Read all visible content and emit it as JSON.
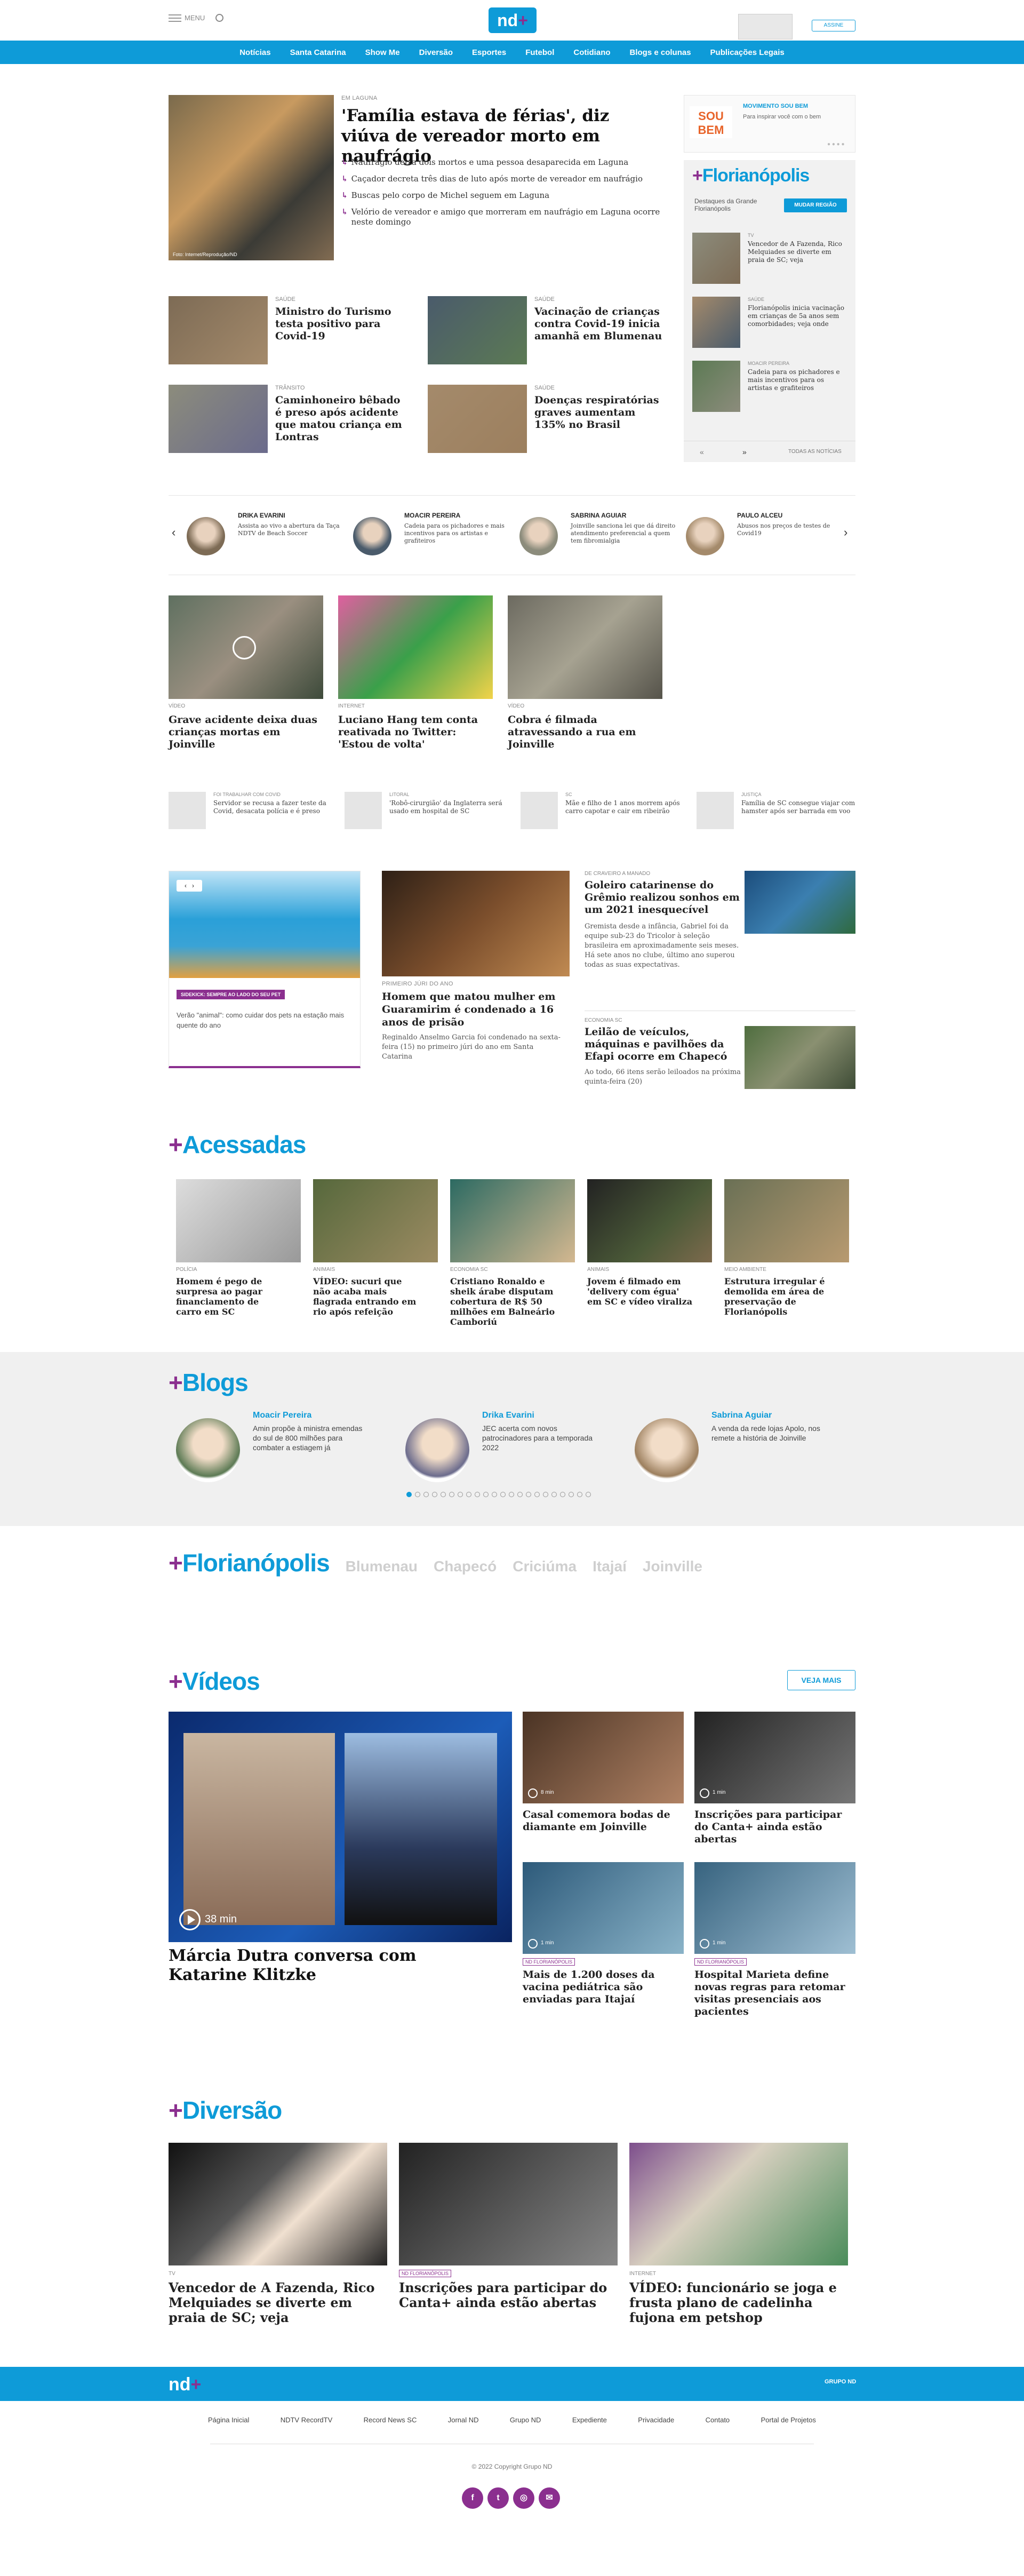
{
  "header": {
    "menu_label": "MENU",
    "subscribe_label": "ASSINE"
  },
  "nav": [
    "Notícias",
    "Santa Catarina",
    "Show Me",
    "Diversão",
    "Esportes",
    "Futebol",
    "Cotidiano",
    "Blogs e colunas",
    "Publicações Legais"
  ],
  "lead": {
    "kicker": "EM LAGUNA",
    "title": "'Família estava de férias', diz viúva de vereador morto em naufrágio",
    "credit": "Foto: Internet/Reprodução/ND",
    "bullets": [
      "Naufrágio deixa dois mortos e uma pessoa desaparecida em Laguna",
      "Caçador decreta três dias de luto após morte de vereador em naufrágio",
      "Buscas pelo corpo de Michel seguem em Laguna",
      "Velório de vereador e amigo que morreram em naufrágio em Laguna ocorre neste domingo"
    ]
  },
  "grid": [
    {
      "kicker": "SAÚDE",
      "title": "Ministro do Turismo testa positivo para Covid-19"
    },
    {
      "kicker": "SAÚDE",
      "title": "Vacinação de crianças contra Covid-19 inicia amanhã em Blumenau"
    },
    {
      "kicker": "TRÂNSITO",
      "title": "Caminhoneiro bêbado é preso após acidente que matou criança em Lontras"
    },
    {
      "kicker": "SAÚDE",
      "title": "Doenças respiratórias graves aumentam 135% no Brasil"
    }
  ],
  "promo": {
    "kicker": "MOVIMENTO SOU BEM",
    "line": "Para inspirar você com o bem",
    "logo": "SOU BEM"
  },
  "floripa_box": {
    "title": "Florianópolis",
    "subtitle": "Destaques da Grande Florianópolis",
    "button": "MUDAR REGIÃO",
    "items": [
      {
        "kicker": "TV",
        "title": "Vencedor de A Fazenda, Rico Melquiades se diverte em praia de SC; veja"
      },
      {
        "kicker": "SAÚDE",
        "title": "Florianópolis inicia vacinação em crianças de 5a anos sem comorbidades; veja onde"
      },
      {
        "kicker": "MOACIR PEREIRA",
        "title": "Cadeia para os pichadores e mais incentivos para os artistas e grafiteiros"
      }
    ],
    "all_label": "TODAS AS NOTÍCIAS"
  },
  "columnists": [
    {
      "name": "DRIKA EVARINI",
      "text": "Assista ao vivo a abertura da Taça NDTV de Beach Soccer"
    },
    {
      "name": "MOACIR PEREIRA",
      "text": "Cadeia para os pichadores e mais incentivos para os artistas e grafiteiros"
    },
    {
      "name": "SABRINA AGUIAR",
      "text": "Joinville sanciona lei que dá direito atendimento preferencial a quem tem fibromialgia"
    },
    {
      "name": "PAULO ALCEU",
      "text": "Abusos nos preços de testes de Covid19"
    }
  ],
  "videos_row": [
    {
      "kicker": "VÍDEO",
      "title": "Grave acidente deixa duas crianças mortas em Joinville"
    },
    {
      "kicker": "INTERNET",
      "title": "Luciano Hang tem conta reativada no Twitter: 'Estou de volta'"
    },
    {
      "kicker": "VÍDEO",
      "title": "Cobra é filmada atravessando a rua em Joinville"
    }
  ],
  "small_row": [
    {
      "kicker": "FOI TRABALHAR COM COVID",
      "title": "Servidor se recusa a fazer teste da Covid, desacata polícia e é preso"
    },
    {
      "kicker": "LITORAL",
      "title": "'Robô-cirurgião' da Inglaterra será usado em hospital de SC"
    },
    {
      "kicker": "SC",
      "title": "Mãe e filho de 1 anos morrem após carro capotar e cair em ribeirão"
    },
    {
      "kicker": "JUSTIÇA",
      "title": "Família de SC consegue viajar com hamster após ser barrada em voo"
    }
  ],
  "pet": {
    "badge": "SIDEKICK: SEMPRE AO LADO DO SEU PET",
    "text": "Verão \"animal\": como cuidar dos pets na estação mais quente do ano"
  },
  "mid_story": {
    "kicker": "PRIMEIRO JÚRI DO ANO",
    "title": "Homem que matou mulher em Guaramirim é condenado a 16 anos de prisão",
    "text": "Reginaldo Anselmo Garcia foi condenado na sexta-feira (15) no primeiro júri do ano em Santa Catarina"
  },
  "right_stories": [
    {
      "kicker": "DE CRAVEIRO A MANADO",
      "title": "Goleiro catarinense do Grêmio realizou sonhos em um 2021 inesquecível",
      "text": "Gremista desde a infância, Gabriel foi da equipe sub-23 do Tricolor à seleção brasileira em aproximadamente seis meses. Há sete anos no clube, último ano superou todas as suas expectativas."
    },
    {
      "kicker": "ECONOMIA SC",
      "title": "Leilão de veículos, máquinas e pavilhões da Efapi ocorre em Chapecó",
      "text": "Ao todo, 66 itens serão leiloados na próxima quinta-feira (20)"
    }
  ],
  "acessadas": {
    "title": "Acessadas",
    "items": [
      {
        "kicker": "POLÍCIA",
        "title": "Homem é pego de surpresa ao pagar financiamento de carro em SC"
      },
      {
        "kicker": "ANIMAIS",
        "title": "VÍDEO: sucuri que não acaba mais flagrada entrando em rio após refeição"
      },
      {
        "kicker": "ECONOMIA SC",
        "title": "Cristiano Ronaldo e sheik árabe disputam cobertura de R$ 50 milhões em Balneário Camboriú"
      },
      {
        "kicker": "ANIMAIS",
        "title": "Jovem é filmado em 'delivery com égua' em SC e vídeo viraliza"
      },
      {
        "kicker": "MEIO AMBIENTE",
        "title": "Estrutura irregular é demolida em área de preservação de Florianópolis"
      }
    ]
  },
  "blogs": {
    "title": "Blogs",
    "items": [
      {
        "name": "Moacir Pereira",
        "text": "Amin propõe à ministra emendas do sul de 800 milhões para combater a estiagem já"
      },
      {
        "name": "Drika Evarini",
        "text": "JEC acerta com novos patrocinadores para a temporada 2022"
      },
      {
        "name": "Sabrina Aguiar",
        "text": "A venda da rede lojas Apolo, nos remete a história de Joinville"
      }
    ]
  },
  "regions": {
    "active": "Florianópolis",
    "others": [
      "Blumenau",
      "Chapecó",
      "Criciúma",
      "Itajaí",
      "Joinville"
    ]
  },
  "videos": {
    "title": "Vídeos",
    "more": "VEJA MAIS",
    "main": {
      "title": "Márcia Dutra conversa com Katarine Klitzke",
      "duration": "38 min"
    },
    "items": [
      {
        "tag": "",
        "title": "Casal comemora bodas de diamante em Joinville",
        "dur": "8 min"
      },
      {
        "tag": "",
        "title": "Inscrições para participar do Canta+ ainda estão abertas",
        "dur": "1 min"
      },
      {
        "tag": "ND FLORIANÓPOLIS",
        "title": "Mais de 1.200 doses da vacina pediátrica são enviadas para Itajaí",
        "dur": "1 min"
      },
      {
        "tag": "ND FLORIANÓPOLIS",
        "title": "Hospital Marieta define novas regras para retomar visitas presenciais aos pacientes",
        "dur": "1 min"
      }
    ]
  },
  "diversao": {
    "title": "Diversão",
    "items": [
      {
        "kicker": "TV",
        "tag": "",
        "title": "Vencedor de A Fazenda, Rico Melquiades se diverte em praia de SC; veja"
      },
      {
        "kicker": "",
        "tag": "ND FLORIANÓPOLIS",
        "title": "Inscrições para participar do Canta+ ainda estão abertas"
      },
      {
        "kicker": "INTERNET",
        "tag": "",
        "title": "VÍDEO: funcionário se joga e frusta plano de cadelinha fujona em petshop"
      }
    ]
  },
  "footer": {
    "group": "GRUPO ND",
    "links": [
      "Página Inicial",
      "NDTV RecordTV",
      "Record News SC",
      "Jornal ND",
      "Grupo ND",
      "Expediente",
      "Privacidade",
      "Contato",
      "Portal de Projetos"
    ],
    "copyright": "© 2022 Copyright Grupo ND"
  },
  "colors": {
    "blue": "#0e9bd8",
    "purple": "#8b2f8f",
    "dark": "#1a1a1a"
  }
}
